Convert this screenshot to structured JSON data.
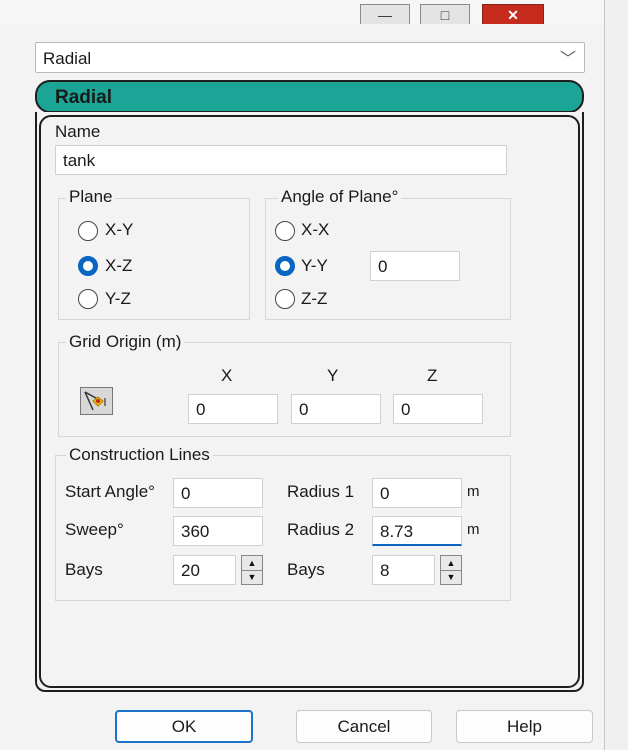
{
  "window": {
    "minimize_icon": "minimize-icon",
    "maximize_icon": "maximize-icon",
    "close_icon": "close-icon",
    "minimize_glyph": "—",
    "maximize_glyph": "□",
    "close_glyph": "✕"
  },
  "type_select": {
    "value": "Radial",
    "chevron": "﹀"
  },
  "header": {
    "title": "Radial"
  },
  "name": {
    "label": "Name",
    "value": "tank"
  },
  "plane": {
    "title": "Plane",
    "options": [
      {
        "label": "X-Y",
        "checked": false
      },
      {
        "label": "X-Z",
        "checked": true
      },
      {
        "label": "Y-Z",
        "checked": false
      }
    ]
  },
  "angle_of_plane": {
    "title": "Angle of Plane°",
    "options": [
      {
        "label": "X-X",
        "checked": false
      },
      {
        "label": "Y-Y",
        "checked": true
      },
      {
        "label": "Z-Z",
        "checked": false
      }
    ],
    "value": "0"
  },
  "grid_origin": {
    "title": "Grid Origin (m)",
    "pick_icon": "pick-point-icon",
    "x_label": "X",
    "y_label": "Y",
    "z_label": "Z",
    "x": "0",
    "y": "0",
    "z": "0"
  },
  "construction_lines": {
    "title": "Construction Lines",
    "start_angle_label": "Start Angle°",
    "start_angle": "0",
    "sweep_label": "Sweep°",
    "sweep": "360",
    "bays_left_label": "Bays",
    "bays_left": "20",
    "radius1_label": "Radius 1",
    "radius1": "0",
    "radius1_unit": "m",
    "radius2_label": "Radius 2",
    "radius2": "8.73",
    "radius2_unit": "m",
    "bays_right_label": "Bays",
    "bays_right": "8",
    "spin_up": "▲",
    "spin_down": "▼"
  },
  "buttons": {
    "ok": "OK",
    "cancel": "Cancel",
    "help": "Help"
  },
  "colors": {
    "header_fill": "#1aa597",
    "accent": "#0a64c2",
    "close": "#c42b1c"
  }
}
